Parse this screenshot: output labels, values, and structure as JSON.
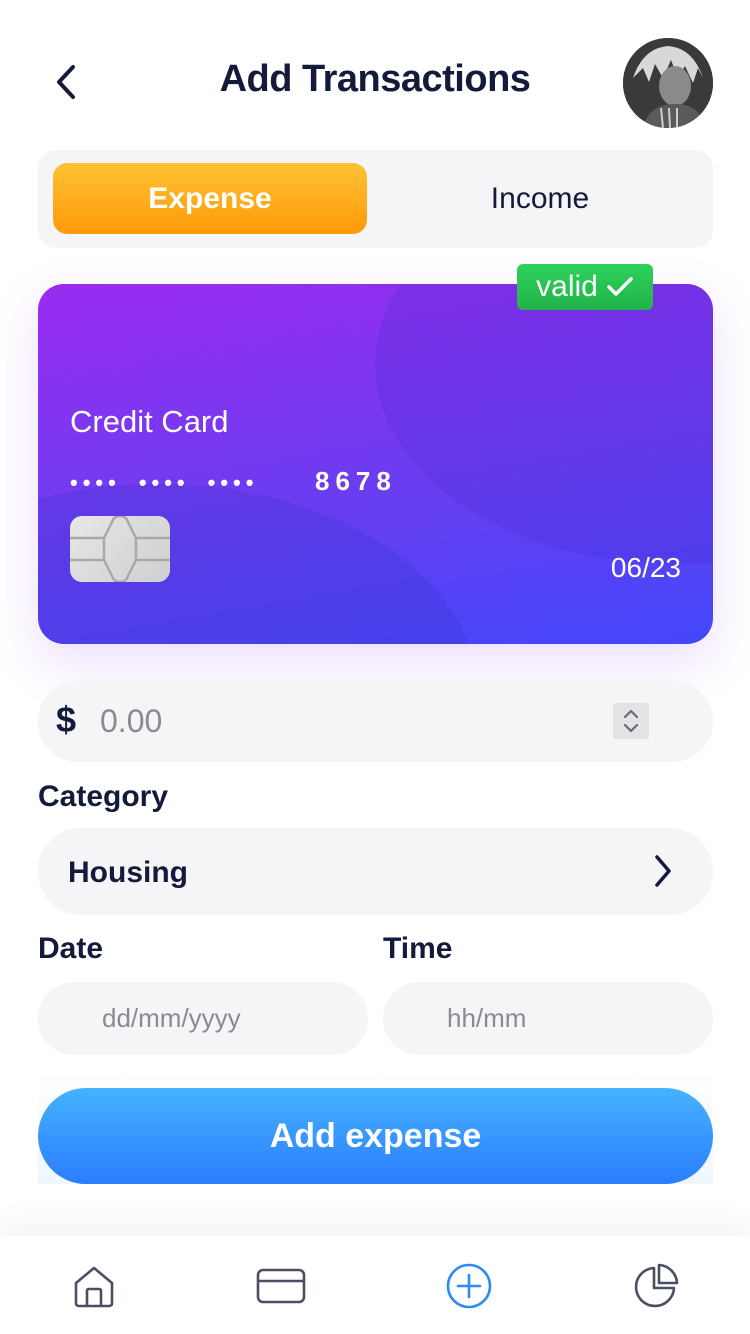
{
  "header": {
    "title": "Add Transactions",
    "back_icon": "chevron-left-icon",
    "avatar": "user-avatar"
  },
  "type_toggle": {
    "expense_label": "Expense",
    "income_label": "Income",
    "selected": "Expense"
  },
  "card": {
    "badge_label": "valid",
    "badge_icon": "check-icon",
    "type": "Credit Card",
    "masked_groups": [
      "••••",
      "••••",
      "••••"
    ],
    "last4": "8678",
    "expiry": "06/23"
  },
  "amount": {
    "currency": "$",
    "placeholder": "0.00"
  },
  "category": {
    "label": "Category",
    "value": "Housing"
  },
  "date": {
    "label": "Date",
    "placeholder": "dd/mm/yyyy"
  },
  "time": {
    "label": "Time",
    "placeholder": "hh/mm"
  },
  "submit": {
    "label": "Add expense"
  },
  "tabbar": {
    "items": [
      "home-icon",
      "card-icon",
      "add-circle-icon",
      "pie-chart-icon"
    ],
    "active": "add-circle-icon"
  },
  "colors": {
    "expense_accent": "#ff9a0a",
    "card_gradient_start": "#9a2cf0",
    "card_gradient_end": "#4347fb",
    "valid_green": "#22b34a",
    "primary_blue": "#2b7dfc",
    "text_dark": "#141a3a"
  }
}
